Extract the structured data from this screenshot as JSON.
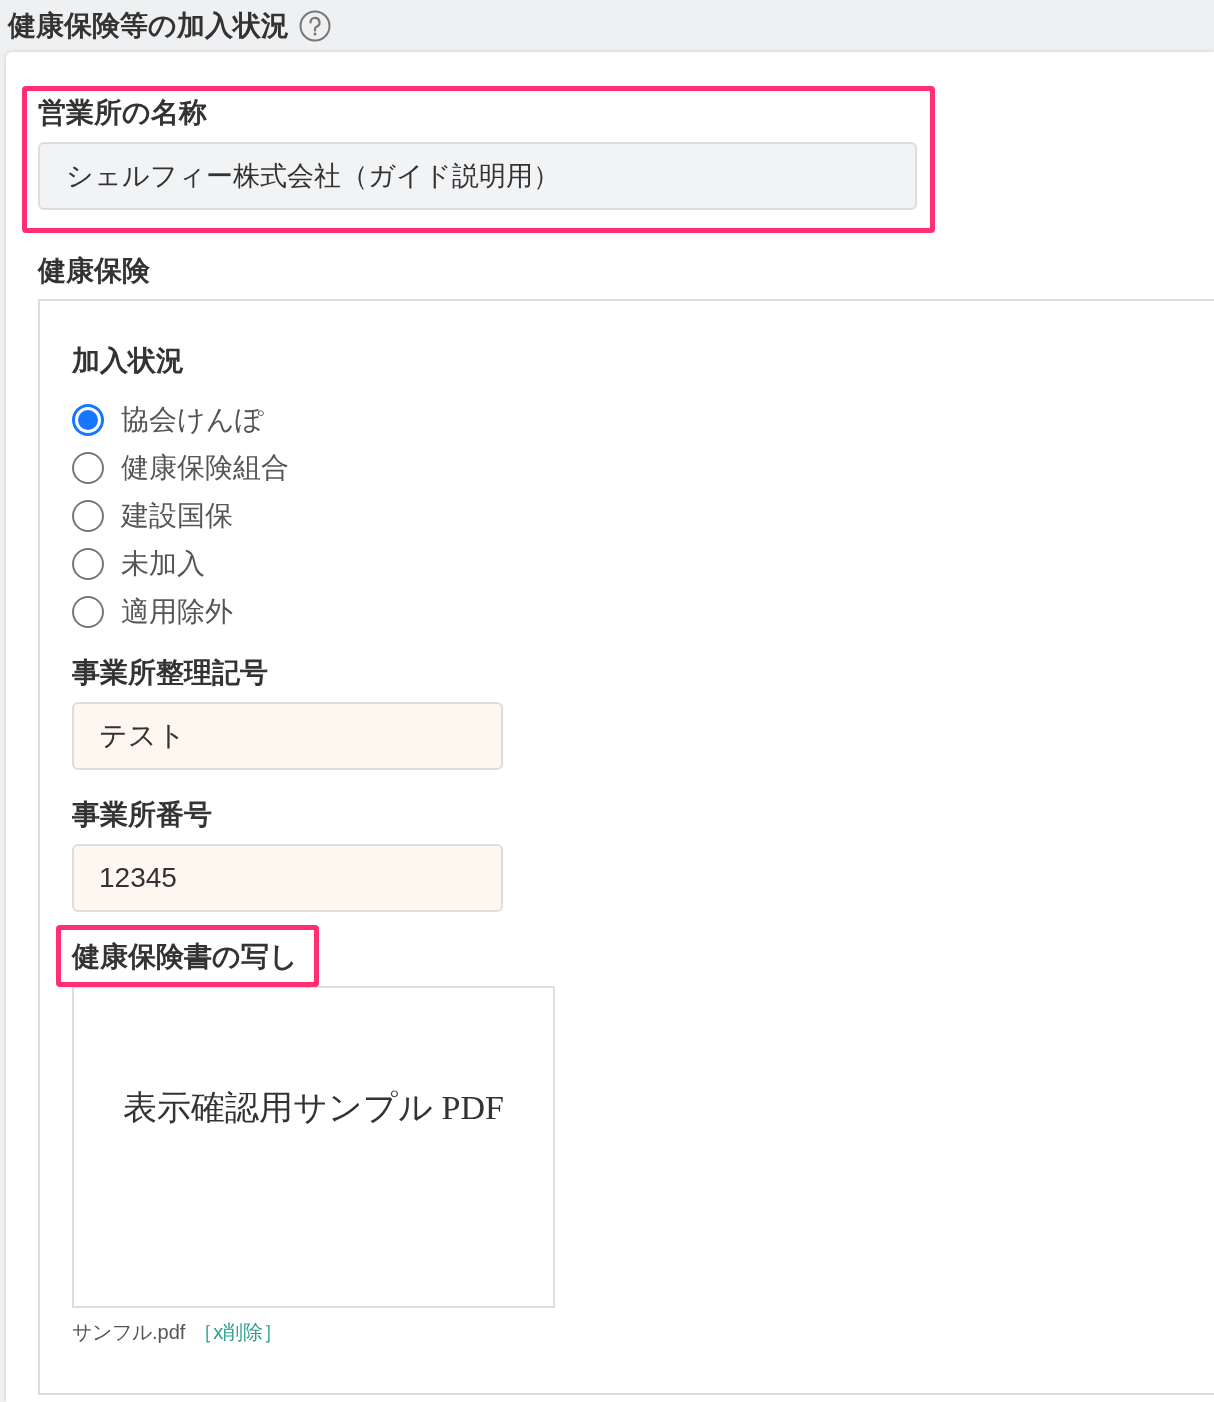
{
  "header": {
    "title": "健康保険等の加入状況"
  },
  "office_name": {
    "label": "営業所の名称",
    "value": "シェルフィー株式会社（ガイド説明用）",
    "highlighted": true
  },
  "health_insurance": {
    "title": "健康保険",
    "enrollment": {
      "label": "加入状況",
      "options": [
        {
          "label": "協会けんぽ",
          "selected": true
        },
        {
          "label": "健康保険組合",
          "selected": false
        },
        {
          "label": "建設国保",
          "selected": false
        },
        {
          "label": "未加入",
          "selected": false
        },
        {
          "label": "適用除外",
          "selected": false
        }
      ]
    },
    "fields": [
      {
        "label": "事業所整理記号",
        "value": "テスト"
      },
      {
        "label": "事業所番号",
        "value": "12345"
      }
    ],
    "document": {
      "label": "健康保険書の写し",
      "highlighted": true,
      "preview_text": "表示確認用サンプル PDF",
      "file_name": "サンフル.pdf",
      "delete_link": "［x削除］"
    }
  }
}
